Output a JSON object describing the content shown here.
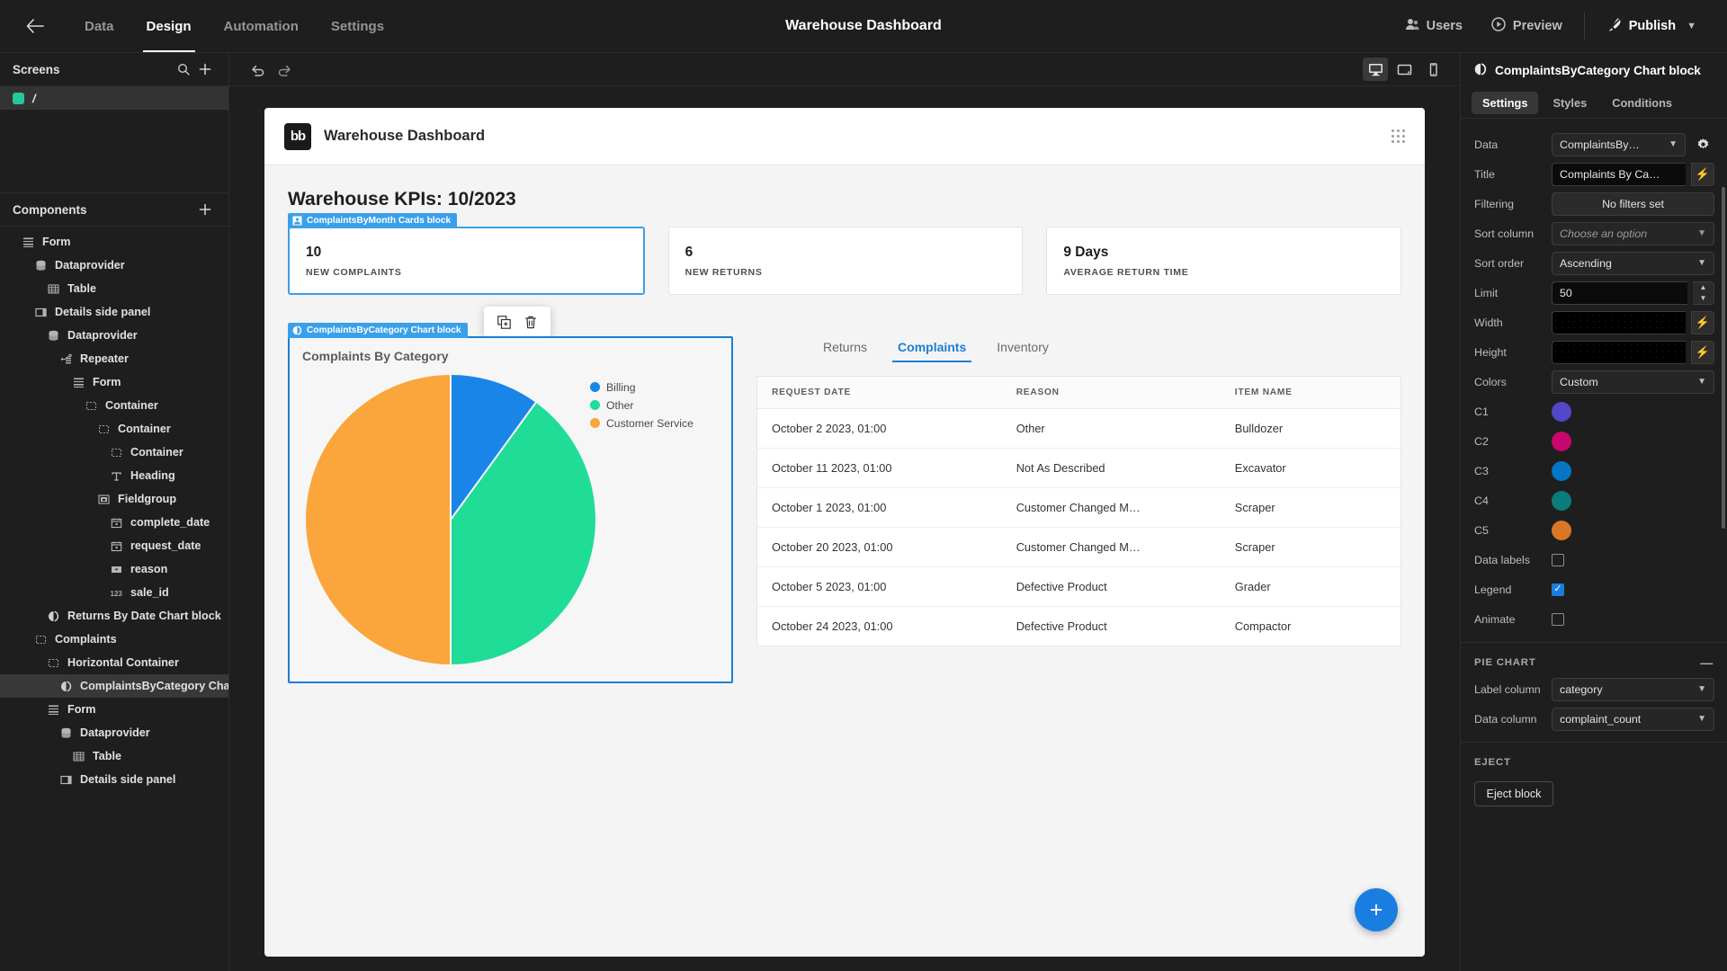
{
  "topbar": {
    "back_icon": "arrow-left-icon",
    "tabs": [
      {
        "label": "Data",
        "active": false
      },
      {
        "label": "Design",
        "active": true
      },
      {
        "label": "Automation",
        "active": false
      },
      {
        "label": "Settings",
        "active": false
      }
    ],
    "title": "Warehouse Dashboard",
    "users_label": "Users",
    "preview_label": "Preview",
    "publish_label": "Publish"
  },
  "screens_panel": {
    "title": "Screens",
    "search_icon": "search-icon",
    "add_icon": "plus-icon",
    "items": [
      {
        "label": "/",
        "selected": true
      }
    ]
  },
  "components_panel": {
    "title": "Components",
    "add_icon": "plus-icon",
    "tree": [
      {
        "label": "Form",
        "icon": "form-icon",
        "depth": 1,
        "selected": false
      },
      {
        "label": "Dataprovider",
        "icon": "database-icon",
        "depth": 2,
        "selected": false
      },
      {
        "label": "Table",
        "icon": "table-icon",
        "depth": 3,
        "selected": false
      },
      {
        "label": "Details side panel",
        "icon": "panel-icon",
        "depth": 2,
        "selected": false
      },
      {
        "label": "Dataprovider",
        "icon": "database-icon",
        "depth": 3,
        "selected": false
      },
      {
        "label": "Repeater",
        "icon": "repeater-icon",
        "depth": 4,
        "selected": false
      },
      {
        "label": "Form",
        "icon": "form-icon",
        "depth": 5,
        "selected": false
      },
      {
        "label": "Container",
        "icon": "container-icon",
        "depth": 6,
        "selected": false
      },
      {
        "label": "Container",
        "icon": "container-icon",
        "depth": 7,
        "selected": false
      },
      {
        "label": "Container",
        "icon": "container-icon",
        "depth": 8,
        "selected": false
      },
      {
        "label": "Heading",
        "icon": "text-icon",
        "depth": 8,
        "selected": false
      },
      {
        "label": "Fieldgroup",
        "icon": "fieldgroup-icon",
        "depth": 7,
        "selected": false
      },
      {
        "label": "complete_date",
        "icon": "date-icon",
        "depth": 8,
        "selected": false
      },
      {
        "label": "request_date",
        "icon": "date-icon",
        "depth": 8,
        "selected": false
      },
      {
        "label": "reason",
        "icon": "select-icon",
        "depth": 8,
        "selected": false
      },
      {
        "label": "sale_id",
        "icon": "number-icon",
        "depth": 8,
        "selected": false
      },
      {
        "label": "Returns By Date Chart block",
        "icon": "chart-icon",
        "depth": 3,
        "selected": false
      },
      {
        "label": "Complaints",
        "icon": "container-icon",
        "depth": 2,
        "selected": false
      },
      {
        "label": "Horizontal Container",
        "icon": "container-icon",
        "depth": 3,
        "selected": false
      },
      {
        "label": "ComplaintsByCategory Char…",
        "icon": "chart-icon",
        "depth": 4,
        "selected": true
      },
      {
        "label": "Form",
        "icon": "form-icon",
        "depth": 3,
        "selected": false
      },
      {
        "label": "Dataprovider",
        "icon": "database-icon",
        "depth": 4,
        "selected": false
      },
      {
        "label": "Table",
        "icon": "table-icon",
        "depth": 5,
        "selected": false
      },
      {
        "label": "Details side panel",
        "icon": "panel-icon",
        "depth": 4,
        "selected": false
      }
    ]
  },
  "center_toolbar": {
    "undo_icon": "undo-icon",
    "redo_icon": "redo-icon",
    "devices": [
      {
        "name": "desktop-icon",
        "active": true
      },
      {
        "name": "tablet-icon",
        "active": false
      },
      {
        "name": "mobile-icon",
        "active": false
      }
    ]
  },
  "canvas": {
    "app_logo": "bb",
    "app_title": "Warehouse Dashboard",
    "grid_icon": "grid-dots-icon",
    "kpi_heading": "Warehouse KPIs: 10/2023",
    "kpi_cards": [
      {
        "value": "10",
        "label": "NEW COMPLAINTS",
        "selected": true
      },
      {
        "value": "6",
        "label": "NEW RETURNS",
        "selected": false
      },
      {
        "value": "9 Days",
        "label": "AVERAGE RETURN TIME",
        "selected": false
      }
    ],
    "cards_block_badge": "ComplaintsByMonth Cards block",
    "chart_block_badge": "ComplaintsByCategory Chart block",
    "float_tools": [
      "duplicate-icon",
      "delete-icon"
    ],
    "tabs": [
      {
        "label": "Returns",
        "active": false
      },
      {
        "label": "Complaints",
        "active": true
      },
      {
        "label": "Inventory",
        "active": false
      }
    ],
    "table": {
      "headers": [
        "REQUEST DATE",
        "REASON",
        "ITEM NAME"
      ],
      "rows": [
        [
          "October 2 2023, 01:00",
          "Other",
          "Bulldozer"
        ],
        [
          "October 11 2023, 01:00",
          "Not As Described",
          "Excavator"
        ],
        [
          "October 1 2023, 01:00",
          "Customer Changed M…",
          "Scraper"
        ],
        [
          "October 20 2023, 01:00",
          "Customer Changed M…",
          "Scraper"
        ],
        [
          "October 5 2023, 01:00",
          "Defective Product",
          "Grader"
        ],
        [
          "October 24 2023, 01:00",
          "Defective Product",
          "Compactor"
        ]
      ]
    },
    "fab_icon": "plus-icon"
  },
  "chart_data": {
    "type": "pie",
    "title": "Complaints By Category",
    "categories": [
      "Billing",
      "Other",
      "Customer Service"
    ],
    "values": [
      10,
      40,
      50
    ],
    "colors": [
      "#1a85e8",
      "#1fdd96",
      "#faa63c"
    ],
    "legend": true,
    "legend_position": "right",
    "data_labels": false,
    "start_angle": 0
  },
  "settings_panel": {
    "block_title": "ComplaintsByCategory Chart block",
    "block_icon": "chart-icon",
    "tabs": [
      {
        "label": "Settings",
        "active": true
      },
      {
        "label": "Styles",
        "active": false
      },
      {
        "label": "Conditions",
        "active": false
      }
    ],
    "fields": {
      "data_label": "Data",
      "data_value": "ComplaintsBy…",
      "gear_icon": "gear-icon",
      "title_label": "Title",
      "title_value": "Complaints By Ca…",
      "filtering_label": "Filtering",
      "filtering_value": "No filters set",
      "sort_column_label": "Sort column",
      "sort_column_value": "Choose an option",
      "sort_order_label": "Sort order",
      "sort_order_value": "Ascending",
      "limit_label": "Limit",
      "limit_value": "50",
      "width_label": "Width",
      "width_value": "",
      "height_label": "Height",
      "height_value": "",
      "colors_label": "Colors",
      "colors_value": "Custom",
      "c1_label": "C1",
      "c1_color": "#5147c9",
      "c2_label": "C2",
      "c2_color": "#c6076b",
      "c3_label": "C3",
      "c3_color": "#0675c6",
      "c4_label": "C4",
      "c4_color": "#0b7b7b",
      "c5_label": "C5",
      "c5_color": "#d97726",
      "data_labels_label": "Data labels",
      "data_labels_checked": false,
      "legend_label": "Legend",
      "legend_checked": true,
      "animate_label": "Animate",
      "animate_checked": false
    },
    "pie_section": {
      "heading": "PIE CHART",
      "label_column_label": "Label column",
      "label_column_value": "category",
      "data_column_label": "Data column",
      "data_column_value": "complaint_count"
    },
    "eject_section": {
      "heading": "EJECT",
      "button_label": "Eject block"
    }
  }
}
